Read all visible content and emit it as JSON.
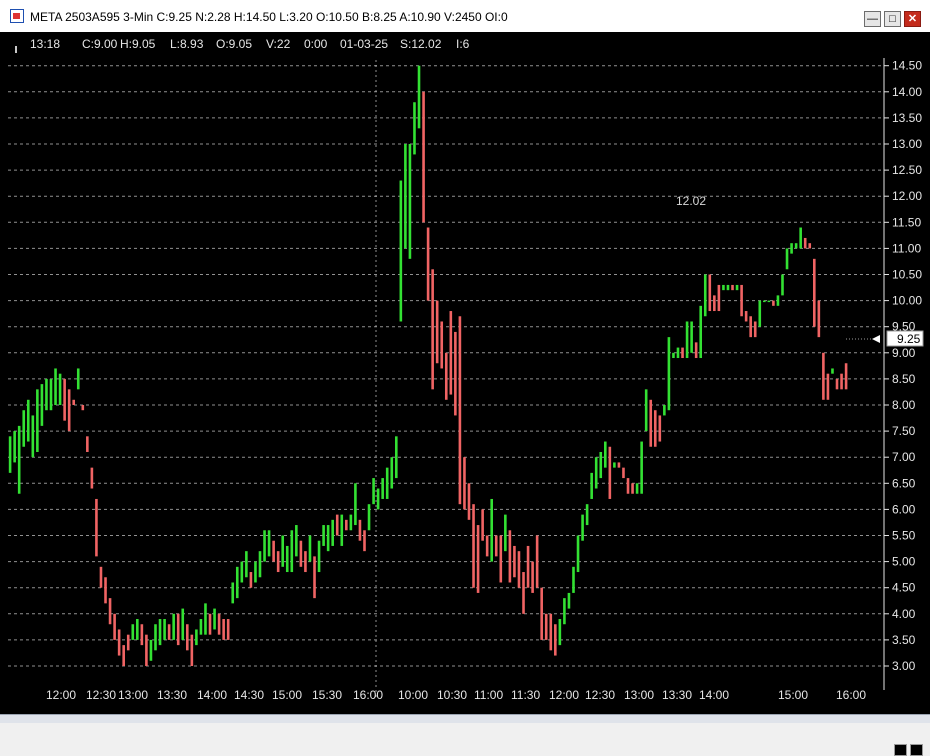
{
  "window": {
    "title": "META 2503A595 3-Min C:9.25 N:2.28 H:14.50 L:3.20 O:10.50 B:8.25 A:10.90 V:2450 OI:0",
    "controls": [
      "minimize",
      "maximize",
      "close"
    ]
  },
  "infobar": {
    "time": "13:18",
    "close": "C:9.00",
    "high": "H:9.05",
    "low": "L:8.93",
    "open": "O:9.05",
    "volume": "V:22",
    "change": "0:00",
    "date": "01-03-25",
    "settle": "S:12.02",
    "interval": "I:6"
  },
  "colors": {
    "background": "#000000",
    "up_bar": "#33e133",
    "down_bar": "#f06464",
    "grid": "#cfcfcf",
    "text": "#e6e6e6"
  },
  "chart_data": {
    "type": "bar",
    "style": "ohlc-bars",
    "symbol": "META 2503A595",
    "interval": "3-Min",
    "ylim": [
      2.7,
      14.8
    ],
    "y_ticks": [
      "3.00",
      "3.50",
      "4.00",
      "4.50",
      "5.00",
      "5.50",
      "6.00",
      "6.50",
      "7.00",
      "7.50",
      "8.00",
      "8.50",
      "9.00",
      "9.50",
      "10.00",
      "10.50",
      "11.00",
      "11.50",
      "12.00",
      "12.50",
      "13.00",
      "13.50",
      "14.00",
      "14.50"
    ],
    "x_ticks": [
      "12:00",
      "12:30",
      "13:00",
      "13:30",
      "14:00",
      "14:30",
      "15:00",
      "15:30",
      "16:00",
      "10:00",
      "10:30",
      "11:00",
      "11:30",
      "12:00",
      "12:30",
      "13:00",
      "13:30",
      "14:00",
      "15:00",
      "16:00"
    ],
    "session_divider": "16:00",
    "annotation": "12.02",
    "last_price_label": "9.25",
    "grid": true,
    "bars": [
      {
        "d": "up",
        "h": 7.4,
        "l": 6.7
      },
      {
        "d": "up",
        "h": 7.5,
        "l": 6.9
      },
      {
        "d": "up",
        "h": 7.6,
        "l": 6.3
      },
      {
        "d": "up",
        "h": 7.9,
        "l": 7.2
      },
      {
        "d": "up",
        "h": 8.1,
        "l": 7.3
      },
      {
        "d": "up",
        "h": 7.8,
        "l": 7.0
      },
      {
        "d": "up",
        "h": 8.3,
        "l": 7.1
      },
      {
        "d": "up",
        "h": 8.4,
        "l": 7.6
      },
      {
        "d": "up",
        "h": 8.5,
        "l": 7.9
      },
      {
        "d": "up",
        "h": 8.5,
        "l": 7.9
      },
      {
        "d": "up",
        "h": 8.7,
        "l": 8.0
      },
      {
        "d": "up",
        "h": 8.6,
        "l": 8.0
      },
      {
        "d": "down",
        "h": 8.5,
        "l": 7.7
      },
      {
        "d": "down",
        "h": 8.3,
        "l": 7.5
      },
      {
        "d": "down",
        "h": 8.1,
        "l": 8.0
      },
      {
        "d": "up",
        "h": 8.7,
        "l": 8.3
      },
      {
        "d": "down",
        "h": 8.0,
        "l": 7.9
      },
      {
        "d": "down",
        "h": 7.4,
        "l": 7.1
      },
      {
        "d": "down",
        "h": 6.8,
        "l": 6.4
      },
      {
        "d": "down",
        "h": 6.2,
        "l": 5.1
      },
      {
        "d": "down",
        "h": 4.9,
        "l": 4.5
      },
      {
        "d": "down",
        "h": 4.7,
        "l": 4.2
      },
      {
        "d": "down",
        "h": 4.3,
        "l": 3.8
      },
      {
        "d": "down",
        "h": 4.0,
        "l": 3.5
      },
      {
        "d": "down",
        "h": 3.7,
        "l": 3.2
      },
      {
        "d": "down",
        "h": 3.4,
        "l": 3.0
      },
      {
        "d": "down",
        "h": 3.6,
        "l": 3.3
      },
      {
        "d": "up",
        "h": 3.8,
        "l": 3.5
      },
      {
        "d": "up",
        "h": 3.9,
        "l": 3.5
      },
      {
        "d": "down",
        "h": 3.8,
        "l": 3.4
      },
      {
        "d": "down",
        "h": 3.6,
        "l": 3.0
      },
      {
        "d": "up",
        "h": 3.5,
        "l": 3.1
      },
      {
        "d": "up",
        "h": 3.8,
        "l": 3.3
      },
      {
        "d": "up",
        "h": 3.9,
        "l": 3.4
      },
      {
        "d": "up",
        "h": 3.9,
        "l": 3.5
      },
      {
        "d": "down",
        "h": 3.8,
        "l": 3.5
      },
      {
        "d": "up",
        "h": 4.0,
        "l": 3.5
      },
      {
        "d": "down",
        "h": 4.0,
        "l": 3.4
      },
      {
        "d": "up",
        "h": 4.1,
        "l": 3.5
      },
      {
        "d": "down",
        "h": 3.8,
        "l": 3.3
      },
      {
        "d": "down",
        "h": 3.6,
        "l": 3.0
      },
      {
        "d": "up",
        "h": 3.7,
        "l": 3.4
      },
      {
        "d": "up",
        "h": 3.9,
        "l": 3.6
      },
      {
        "d": "up",
        "h": 4.2,
        "l": 3.6
      },
      {
        "d": "down",
        "h": 4.0,
        "l": 3.6
      },
      {
        "d": "up",
        "h": 4.1,
        "l": 3.7
      },
      {
        "d": "down",
        "h": 4.0,
        "l": 3.6
      },
      {
        "d": "down",
        "h": 3.9,
        "l": 3.5
      },
      {
        "d": "down",
        "h": 3.9,
        "l": 3.5
      },
      {
        "d": "up",
        "h": 4.6,
        "l": 4.2
      },
      {
        "d": "up",
        "h": 4.9,
        "l": 4.3
      },
      {
        "d": "up",
        "h": 5.0,
        "l": 4.6
      },
      {
        "d": "up",
        "h": 5.2,
        "l": 4.7
      },
      {
        "d": "down",
        "h": 4.8,
        "l": 4.5
      },
      {
        "d": "up",
        "h": 5.0,
        "l": 4.6
      },
      {
        "d": "up",
        "h": 5.2,
        "l": 4.7
      },
      {
        "d": "up",
        "h": 5.6,
        "l": 5.0
      },
      {
        "d": "up",
        "h": 5.6,
        "l": 5.1
      },
      {
        "d": "down",
        "h": 5.4,
        "l": 5.0
      },
      {
        "d": "down",
        "h": 5.2,
        "l": 4.8
      },
      {
        "d": "up",
        "h": 5.5,
        "l": 4.9
      },
      {
        "d": "up",
        "h": 5.3,
        "l": 4.8
      },
      {
        "d": "up",
        "h": 5.6,
        "l": 4.8
      },
      {
        "d": "up",
        "h": 5.7,
        "l": 5.1
      },
      {
        "d": "down",
        "h": 5.4,
        "l": 4.9
      },
      {
        "d": "down",
        "h": 5.2,
        "l": 4.8
      },
      {
        "d": "up",
        "h": 5.5,
        "l": 5.0
      },
      {
        "d": "down",
        "h": 5.1,
        "l": 4.3
      },
      {
        "d": "up",
        "h": 5.4,
        "l": 4.8
      },
      {
        "d": "up",
        "h": 5.7,
        "l": 5.3
      },
      {
        "d": "up",
        "h": 5.7,
        "l": 5.2
      },
      {
        "d": "up",
        "h": 5.8,
        "l": 5.3
      },
      {
        "d": "down",
        "h": 5.9,
        "l": 5.5
      },
      {
        "d": "up",
        "h": 5.9,
        "l": 5.3
      },
      {
        "d": "down",
        "h": 5.8,
        "l": 5.6
      },
      {
        "d": "up",
        "h": 5.9,
        "l": 5.6
      },
      {
        "d": "up",
        "h": 6.5,
        "l": 5.7
      },
      {
        "d": "down",
        "h": 5.8,
        "l": 5.4
      },
      {
        "d": "down",
        "h": 5.6,
        "l": 5.2
      },
      {
        "d": "up",
        "h": 6.1,
        "l": 5.6
      },
      {
        "d": "up",
        "h": 6.6,
        "l": 6.1
      },
      {
        "d": "up",
        "h": 6.4,
        "l": 6.0
      },
      {
        "d": "up",
        "h": 6.6,
        "l": 6.2
      },
      {
        "d": "up",
        "h": 6.8,
        "l": 6.2
      },
      {
        "d": "up",
        "h": 7.0,
        "l": 6.4
      },
      {
        "d": "up",
        "h": 7.4,
        "l": 6.6
      },
      {
        "d": "up",
        "h": 12.3,
        "l": 9.6
      },
      {
        "d": "up",
        "h": 13.0,
        "l": 11.0
      },
      {
        "d": "up",
        "h": 13.0,
        "l": 10.8
      },
      {
        "d": "up",
        "h": 13.8,
        "l": 12.8
      },
      {
        "d": "up",
        "h": 14.5,
        "l": 13.3
      },
      {
        "d": "down",
        "h": 14.0,
        "l": 11.5
      },
      {
        "d": "down",
        "h": 11.4,
        "l": 10.0
      },
      {
        "d": "down",
        "h": 10.6,
        "l": 8.3
      },
      {
        "d": "down",
        "h": 10.0,
        "l": 8.8
      },
      {
        "d": "down",
        "h": 9.6,
        "l": 8.7
      },
      {
        "d": "down",
        "h": 9.0,
        "l": 8.1
      },
      {
        "d": "down",
        "h": 9.8,
        "l": 8.2
      },
      {
        "d": "down",
        "h": 9.4,
        "l": 7.8
      },
      {
        "d": "down",
        "h": 9.7,
        "l": 6.1
      },
      {
        "d": "down",
        "h": 7.0,
        "l": 6.0
      },
      {
        "d": "down",
        "h": 6.5,
        "l": 5.8
      },
      {
        "d": "down",
        "h": 6.1,
        "l": 4.5
      },
      {
        "d": "down",
        "h": 5.7,
        "l": 4.4
      },
      {
        "d": "down",
        "h": 6.0,
        "l": 5.4
      },
      {
        "d": "down",
        "h": 5.5,
        "l": 5.1
      },
      {
        "d": "up",
        "h": 6.2,
        "l": 5.0
      },
      {
        "d": "down",
        "h": 5.5,
        "l": 5.1
      },
      {
        "d": "down",
        "h": 5.5,
        "l": 4.6
      },
      {
        "d": "up",
        "h": 5.9,
        "l": 5.2
      },
      {
        "d": "down",
        "h": 5.6,
        "l": 4.6
      },
      {
        "d": "down",
        "h": 5.3,
        "l": 4.7
      },
      {
        "d": "down",
        "h": 5.2,
        "l": 4.5
      },
      {
        "d": "down",
        "h": 4.8,
        "l": 4.0
      },
      {
        "d": "down",
        "h": 5.3,
        "l": 4.5
      },
      {
        "d": "down",
        "h": 5.0,
        "l": 4.4
      },
      {
        "d": "down",
        "h": 5.5,
        "l": 4.5
      },
      {
        "d": "down",
        "h": 4.5,
        "l": 3.5
      },
      {
        "d": "down",
        "h": 4.0,
        "l": 3.5
      },
      {
        "d": "down",
        "h": 4.0,
        "l": 3.3
      },
      {
        "d": "down",
        "h": 3.8,
        "l": 3.2
      },
      {
        "d": "up",
        "h": 3.9,
        "l": 3.4
      },
      {
        "d": "up",
        "h": 4.3,
        "l": 3.8
      },
      {
        "d": "up",
        "h": 4.4,
        "l": 4.1
      },
      {
        "d": "up",
        "h": 4.9,
        "l": 4.4
      },
      {
        "d": "up",
        "h": 5.5,
        "l": 4.8
      },
      {
        "d": "up",
        "h": 5.9,
        "l": 5.4
      },
      {
        "d": "up",
        "h": 6.1,
        "l": 5.7
      },
      {
        "d": "up",
        "h": 6.7,
        "l": 6.2
      },
      {
        "d": "up",
        "h": 7.0,
        "l": 6.4
      },
      {
        "d": "up",
        "h": 7.1,
        "l": 6.6
      },
      {
        "d": "up",
        "h": 7.3,
        "l": 6.8
      },
      {
        "d": "down",
        "h": 7.2,
        "l": 6.2
      },
      {
        "d": "up",
        "h": 6.9,
        "l": 6.8
      },
      {
        "d": "down",
        "h": 6.9,
        "l": 6.8
      },
      {
        "d": "down",
        "h": 6.8,
        "l": 6.6
      },
      {
        "d": "down",
        "h": 6.6,
        "l": 6.3
      },
      {
        "d": "down",
        "h": 6.5,
        "l": 6.3
      },
      {
        "d": "up",
        "h": 6.5,
        "l": 6.3
      },
      {
        "d": "up",
        "h": 7.3,
        "l": 6.3
      },
      {
        "d": "up",
        "h": 8.3,
        "l": 7.5
      },
      {
        "d": "down",
        "h": 8.1,
        "l": 7.2
      },
      {
        "d": "down",
        "h": 7.9,
        "l": 7.2
      },
      {
        "d": "down",
        "h": 7.8,
        "l": 7.3
      },
      {
        "d": "up",
        "h": 8.0,
        "l": 7.8
      },
      {
        "d": "up",
        "h": 9.3,
        "l": 7.9
      },
      {
        "d": "up",
        "h": 9.0,
        "l": 8.9
      },
      {
        "d": "up",
        "h": 9.1,
        "l": 8.9
      },
      {
        "d": "down",
        "h": 9.1,
        "l": 8.9
      },
      {
        "d": "up",
        "h": 9.6,
        "l": 8.9
      },
      {
        "d": "up",
        "h": 9.6,
        "l": 9.0
      },
      {
        "d": "down",
        "h": 9.2,
        "l": 8.9
      },
      {
        "d": "up",
        "h": 9.9,
        "l": 8.9
      },
      {
        "d": "up",
        "h": 10.5,
        "l": 9.7
      },
      {
        "d": "down",
        "h": 10.5,
        "l": 9.8
      },
      {
        "d": "down",
        "h": 10.1,
        "l": 9.8
      },
      {
        "d": "down",
        "h": 10.3,
        "l": 9.8
      },
      {
        "d": "up",
        "h": 10.3,
        "l": 10.2
      },
      {
        "d": "up",
        "h": 10.3,
        "l": 10.2
      },
      {
        "d": "down",
        "h": 10.3,
        "l": 10.2
      },
      {
        "d": "up",
        "h": 10.3,
        "l": 10.2
      },
      {
        "d": "down",
        "h": 10.3,
        "l": 9.7
      },
      {
        "d": "down",
        "h": 9.8,
        "l": 9.6
      },
      {
        "d": "down",
        "h": 9.7,
        "l": 9.3
      },
      {
        "d": "down",
        "h": 9.6,
        "l": 9.3
      },
      {
        "d": "up",
        "h": 10.0,
        "l": 9.5
      },
      {
        "d": "up",
        "h": 10.0,
        "l": 10.0
      },
      {
        "d": "up",
        "h": 10.0,
        "l": 10.0
      },
      {
        "d": "down",
        "h": 10.0,
        "l": 9.9
      },
      {
        "d": "up",
        "h": 10.1,
        "l": 9.9
      },
      {
        "d": "up",
        "h": 10.5,
        "l": 10.1
      },
      {
        "d": "up",
        "h": 11.0,
        "l": 10.6
      },
      {
        "d": "up",
        "h": 11.1,
        "l": 10.9
      },
      {
        "d": "up",
        "h": 11.1,
        "l": 11.0
      },
      {
        "d": "up",
        "h": 11.4,
        "l": 11.0
      },
      {
        "d": "down",
        "h": 11.2,
        "l": 11.0
      },
      {
        "d": "down",
        "h": 11.1,
        "l": 11.0
      },
      {
        "d": "down",
        "h": 10.8,
        "l": 9.5
      },
      {
        "d": "down",
        "h": 10.0,
        "l": 9.3
      },
      {
        "d": "down",
        "h": 9.0,
        "l": 8.1
      },
      {
        "d": "down",
        "h": 8.6,
        "l": 8.1
      },
      {
        "d": "up",
        "h": 8.7,
        "l": 8.6
      },
      {
        "d": "down",
        "h": 8.5,
        "l": 8.3
      },
      {
        "d": "down",
        "h": 8.6,
        "l": 8.3
      },
      {
        "d": "down",
        "h": 8.8,
        "l": 8.3
      }
    ]
  }
}
